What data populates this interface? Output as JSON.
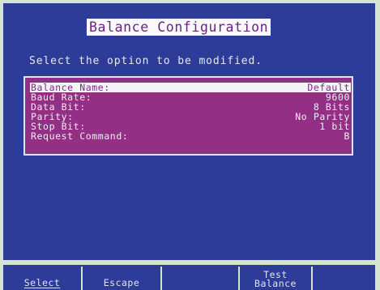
{
  "screen": {
    "title": "Balance Configuration",
    "prompt": "Select the option to be modified."
  },
  "settings": [
    {
      "label": "Balance Name:",
      "value": "Default",
      "selected": true
    },
    {
      "label": "Baud Rate:",
      "value": "9600",
      "selected": false
    },
    {
      "label": "Data Bit:",
      "value": "8 Bits",
      "selected": false
    },
    {
      "label": "Parity:",
      "value": "No Parity",
      "selected": false
    },
    {
      "label": "Stop Bit:",
      "value": "1 bit",
      "selected": false
    },
    {
      "label": "Request Command:",
      "value": "B",
      "selected": false
    }
  ],
  "softkeys": {
    "select": "Select",
    "escape": "Escape",
    "blank": "",
    "test_balance_line1": "Test",
    "test_balance_line2": "Balance",
    "blank2": ""
  },
  "colors": {
    "panel_blue": "#2c3c98",
    "list_purple": "#942f86",
    "highlight_white": "#f4f4f6",
    "bezel_green": "#d6e6ce"
  }
}
